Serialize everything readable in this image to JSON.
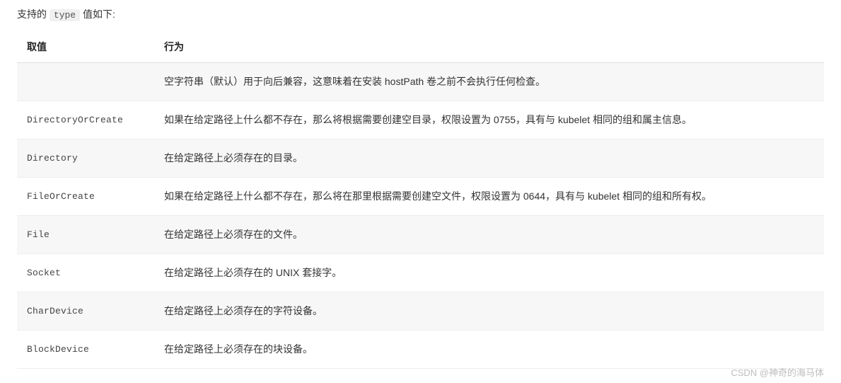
{
  "intro": {
    "prefix": "支持的 ",
    "code": "type",
    "suffix": " 值如下:"
  },
  "table": {
    "headers": {
      "col1": "取值",
      "col2": "行为"
    },
    "rows": [
      {
        "type": "",
        "behavior": "空字符串（默认）用于向后兼容，这意味着在安装 hostPath 卷之前不会执行任何检查。"
      },
      {
        "type": "DirectoryOrCreate",
        "behavior": "如果在给定路径上什么都不存在，那么将根据需要创建空目录，权限设置为 0755，具有与 kubelet 相同的组和属主信息。"
      },
      {
        "type": "Directory",
        "behavior": "在给定路径上必须存在的目录。"
      },
      {
        "type": "FileOrCreate",
        "behavior": "如果在给定路径上什么都不存在，那么将在那里根据需要创建空文件，权限设置为 0644，具有与 kubelet 相同的组和所有权。"
      },
      {
        "type": "File",
        "behavior": "在给定路径上必须存在的文件。"
      },
      {
        "type": "Socket",
        "behavior": "在给定路径上必须存在的 UNIX 套接字。"
      },
      {
        "type": "CharDevice",
        "behavior": "在给定路径上必须存在的字符设备。"
      },
      {
        "type": "BlockDevice",
        "behavior": "在给定路径上必须存在的块设备。"
      }
    ]
  },
  "watermark": "CSDN @神奇的海马体"
}
